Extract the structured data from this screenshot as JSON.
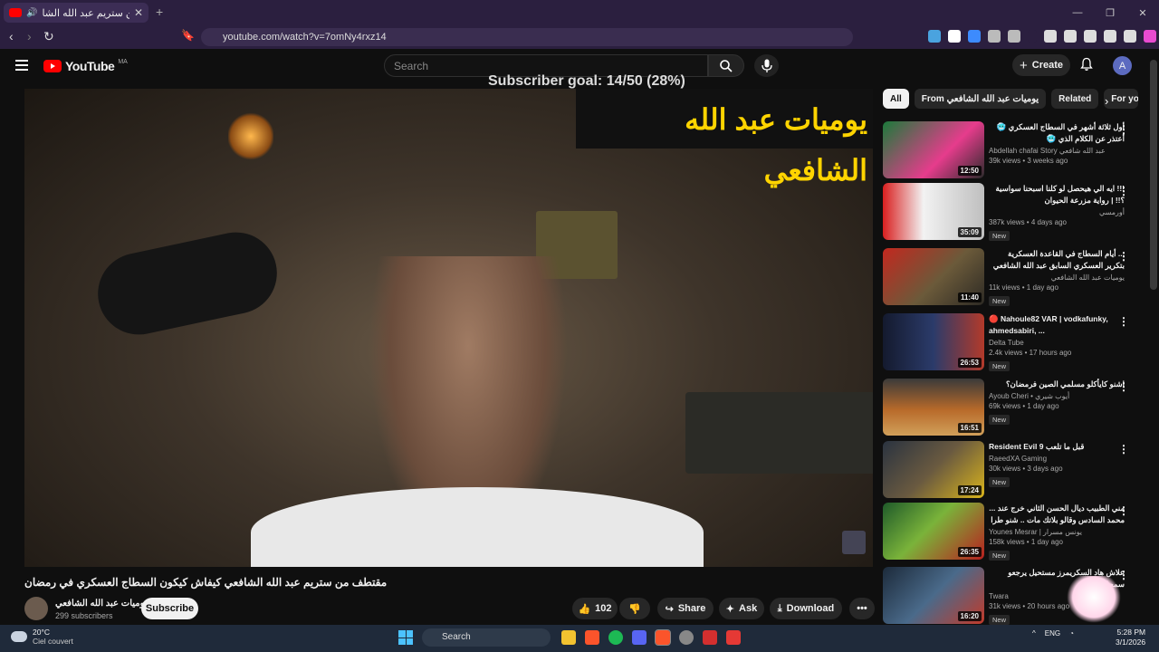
{
  "browser": {
    "tab_title": "مقتطف من ستريم عبد الله الشا",
    "url": "youtube.com/watch?v=7omNy4rxz14",
    "new_tab": "+",
    "close": "✕"
  },
  "header": {
    "logo_text": "YouTube",
    "country_code": "MA",
    "search_placeholder": "Search",
    "create_label": "Create",
    "avatar_letter": "A",
    "subscriber_goal": "Subscriber goal: 14/50 (28%)"
  },
  "video": {
    "banner_text": "يوميات عبد الله الشافعي",
    "title": "مقتطف من ستريم عبد الله الشافعي كيفاش كيكون السطاج العسكري في رمضان",
    "channel_name": "يوميات عبد الله الشافعي",
    "subscribers": "299 subscribers",
    "subscribe_label": "Subscribe",
    "likes": "102",
    "share_label": "Share",
    "ask_label": "Ask",
    "download_label": "Download"
  },
  "chips": [
    "All",
    "From يوميات عبد الله الشافعي",
    "Related",
    "For yo"
  ],
  "recommendations": [
    {
      "title": "أول ثلاثة أشهر في السطاج العسكري 🥶 أعتذر عن الكلام الذي 🥶",
      "channel": "Abdellah chafai Story عبد الله شافعي",
      "meta": "39k views • 3 weeks ago",
      "duration": "12:50",
      "badge": ""
    },
    {
      "title": "!!! ايه الي هيحصل لو كلنا اسبحنا سواسية ؟!! | رواية مزرعة الحيوان",
      "channel": "أورمسي",
      "meta": "387k views • 4 days ago",
      "duration": "35:09",
      "badge": "New"
    },
    {
      "title": "... أيام السطاج في القاعدة العسكرية بتكرير العسكري السابق عبد الله الشافعي يحكي",
      "channel": "يوميات عبد الله الشافعي",
      "meta": "11k views • 1 day ago",
      "duration": "11:40",
      "badge": "New"
    },
    {
      "title": "🔴 Nahoule82 VAR | vodkafunky, ahmedsabiri, ...",
      "channel": "Delta Tube",
      "meta": "2.4k views • 17 hours ago",
      "duration": "26:53",
      "badge": "New"
    },
    {
      "title": "اشنو كايأكلو مسلمي الصين فرمضان؟",
      "channel": "Ayoub Cheri • أيوب شيري",
      "meta": "69k views • 1 day ago",
      "duration": "16:51",
      "badge": "New"
    },
    {
      "title": "Resident Evil 9 قبل ما تلعب",
      "channel": "RaeedXA Gaming",
      "meta": "30k views • 3 days ago",
      "duration": "17:24",
      "badge": "New"
    },
    {
      "title": "مني الطبيب ديال الحسن الثاني خرج عند ... محمد السادس وقالو بلاتك مات .. شنو طرا في",
      "channel": "Younes Mesrar | يونس مسرار",
      "meta": "158k views • 1 day ago",
      "duration": "26:35",
      "badge": "New"
    },
    {
      "title": "علاش هاد السكريمرز مستحيل يرجعو سمجاب؟",
      "channel": "Twara",
      "meta": "31k views • 20 hours ago",
      "duration": "16:20",
      "badge": "New"
    }
  ],
  "taskbar": {
    "temperature": "20°C",
    "weather_text": "Ciel couvert",
    "search_label": "Search",
    "lang": "ENG",
    "time": "5:28 PM",
    "date": "3/1/2026"
  }
}
